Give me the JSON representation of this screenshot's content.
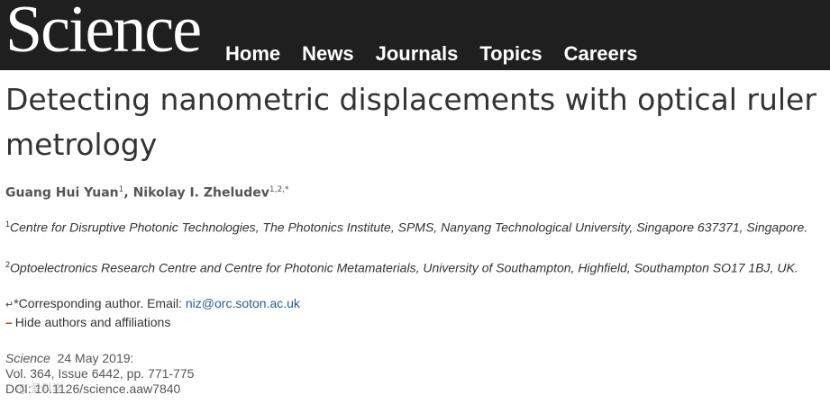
{
  "header": {
    "logo": "Science",
    "nav": [
      "Home",
      "News",
      "Journals",
      "Topics",
      "Careers"
    ]
  },
  "article": {
    "title": "Detecting nanometric displacements with optical ruler metrology",
    "authors": [
      {
        "name": "Guang Hui Yuan",
        "sup": "1"
      },
      {
        "name": "Nikolay I. Zheludev",
        "sup": "1,2,*"
      }
    ],
    "affiliations": [
      {
        "sup": "1",
        "text": "Centre for Disruptive Photonic Technologies, The Photonics Institute, SPMS, Nanyang Technological University, Singapore 637371, Singapore."
      },
      {
        "sup": "2",
        "text": "Optoelectronics Research Centre and Centre for Photonic Metamaterials, University of Southampton, Highfield, Southampton SO17 1BJ, UK."
      }
    ],
    "corresponding": {
      "symbol": "↵",
      "label": "*Corresponding author. Email: ",
      "email": "niz@orc.soton.ac.uk"
    },
    "toggle": {
      "symbol": "–",
      "label": "Hide authors and affiliations"
    },
    "citation": {
      "journal": "Science",
      "date": "24 May 2019:",
      "volume": "Vol. 364, Issue 6442, pp. 771-775",
      "doi": "DOI: 10.1126/science.aaw7840"
    }
  },
  "watermark": "@ 爱科学"
}
